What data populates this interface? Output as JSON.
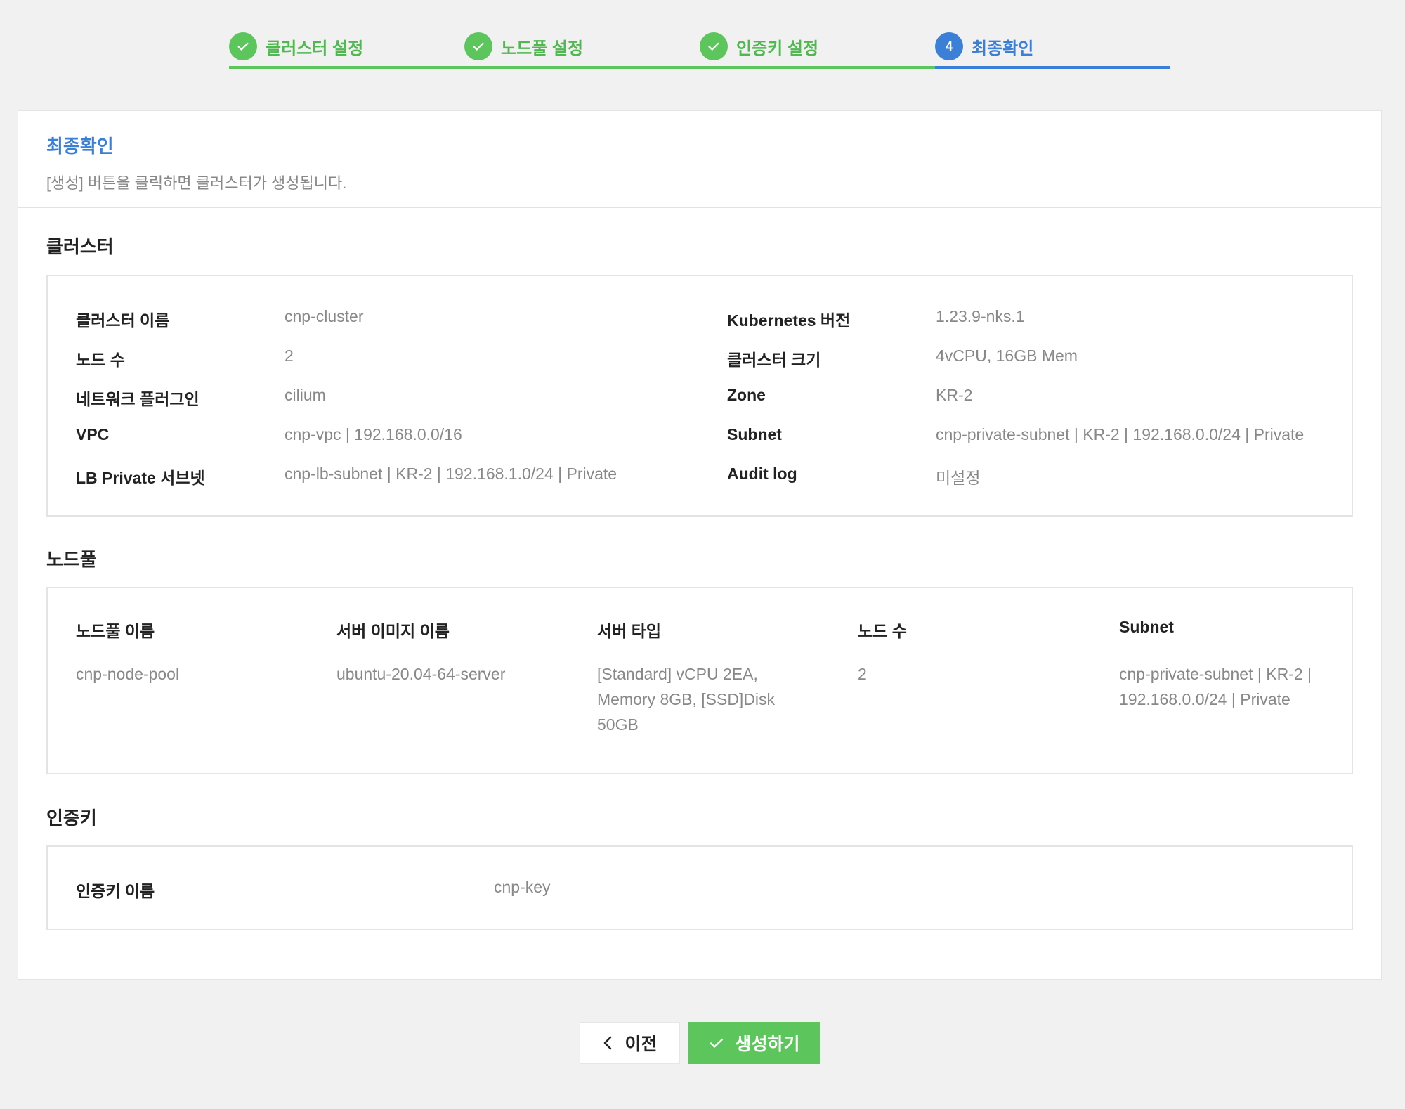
{
  "stepper": {
    "steps": [
      {
        "label": "클러스터 설정",
        "state": "done"
      },
      {
        "label": "노드풀 설정",
        "state": "done"
      },
      {
        "label": "인증키 설정",
        "state": "done"
      },
      {
        "label": "최종확인",
        "state": "current",
        "number": "4"
      }
    ]
  },
  "header": {
    "title": "최종확인",
    "description": "[생성] 버튼을 클릭하면 클러스터가 생성됩니다."
  },
  "cluster": {
    "section_title": "클러스터",
    "left": [
      {
        "key": "클러스터 이름",
        "value": "cnp-cluster"
      },
      {
        "key": "노드 수",
        "value": "2"
      },
      {
        "key": "네트워크 플러그인",
        "value": "cilium"
      },
      {
        "key": "VPC",
        "value": "cnp-vpc | 192.168.0.0/16"
      },
      {
        "key": "LB Private 서브넷",
        "value": "cnp-lb-subnet | KR-2 | 192.168.1.0/24 | Private"
      }
    ],
    "right": [
      {
        "key": "Kubernetes 버전",
        "value": "1.23.9-nks.1"
      },
      {
        "key": "클러스터 크기",
        "value": "4vCPU, 16GB Mem"
      },
      {
        "key": "Zone",
        "value": "KR-2"
      },
      {
        "key": "Subnet",
        "value": "cnp-private-subnet | KR-2 | 192.168.0.0/24 | Private"
      },
      {
        "key": "Audit log",
        "value": "미설정"
      }
    ]
  },
  "nodepool": {
    "section_title": "노드풀",
    "columns": [
      "노드풀 이름",
      "서버 이미지 이름",
      "서버 타입",
      "노드 수",
      "Subnet"
    ],
    "row": {
      "name": "cnp-node-pool",
      "image": "ubuntu-20.04-64-server",
      "server_type_line1": "[Standard] vCPU 2EA,",
      "server_type_line2": "Memory 8GB, [SSD]Disk",
      "server_type_line3": "50GB",
      "node_count": "2",
      "subnet_line1": "cnp-private-subnet | KR-2 |",
      "subnet_line2": "192.168.0.0/24 | Private"
    }
  },
  "authkey": {
    "section_title": "인증키",
    "key": "인증키 이름",
    "value": "cnp-key"
  },
  "buttons": {
    "prev_label": "이전",
    "create_label": "생성하기"
  },
  "colors": {
    "done": "#5cc55c",
    "current": "#3b7fd6",
    "background": "#f1f1f1"
  },
  "icons": {
    "step_done": "check-icon",
    "prev": "chevron-left-icon",
    "create": "check-icon"
  }
}
